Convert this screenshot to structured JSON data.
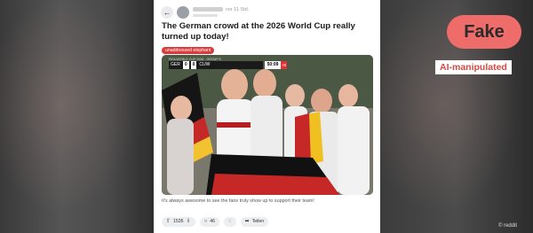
{
  "post": {
    "meta_text": "vor 11 Std.",
    "title": "The German crowd at the 2026 World Cup really turned up today!",
    "flair": "unaddressed elephant",
    "caption": "It's always awesome to see the fans truly show up to support their team!",
    "scoreboard": {
      "header": "FIFA WORLD CUP 2026 · GROUP E",
      "team_left": "GER",
      "score_left": "0",
      "score_right": "0",
      "team_right": "CUW",
      "clock": "50:09",
      "added_time": "+8"
    },
    "actions": {
      "votes": "1535",
      "comments": "46",
      "share_label": "Teilen"
    }
  },
  "overlay": {
    "badge": "Fake",
    "label": "AI-manipulated",
    "credit": "© reddit"
  },
  "colors": {
    "badge_bg": "#ee6c6a",
    "label_text": "#d9473f",
    "flair_bg": "#d93a3a"
  }
}
